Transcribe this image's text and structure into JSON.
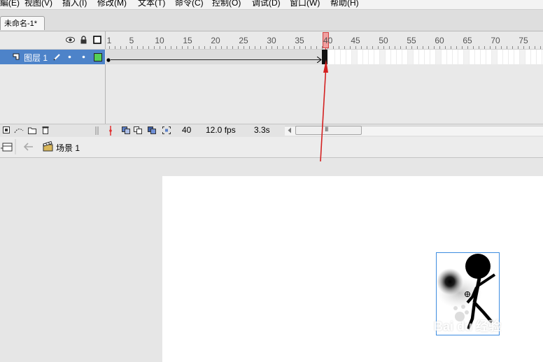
{
  "menu": {
    "items": [
      {
        "label": "編(E)"
      },
      {
        "label": "视图(V)"
      },
      {
        "label": "插入(I)"
      },
      {
        "label": "修改(M)"
      },
      {
        "label": "文本(T)"
      },
      {
        "label": "命令(C)"
      },
      {
        "label": "控制(O)"
      },
      {
        "label": "调试(D)"
      },
      {
        "label": "窗口(W)"
      },
      {
        "label": "帮助(H)"
      }
    ]
  },
  "document_tab": {
    "title": "未命名-1*"
  },
  "timeline": {
    "ruler_labels": [
      "1",
      "5",
      "10",
      "15",
      "20",
      "25",
      "30",
      "35",
      "40",
      "45",
      "50",
      "55",
      "60",
      "65",
      "70",
      "75"
    ],
    "current_frame_marker": "40",
    "layer": {
      "name": "图层 1",
      "icons": [
        "layer-icon",
        "pencil-icon",
        "eye-dot",
        "lock-dot",
        "outline-color-square"
      ]
    },
    "outline_color": "#55d055",
    "header_icons": [
      "eye-icon",
      "lock-icon",
      "outline-icon"
    ],
    "status": {
      "current_frame": "40",
      "frame_rate": "12.0 fps",
      "elapsed_time": "3.3s"
    },
    "scrollbar_grip": "III"
  },
  "scene_bar": {
    "scene_label": "场景 1"
  },
  "stage": {
    "watermark": "Bai du 经验",
    "selection_color": "#3c8ce0"
  },
  "accent_colors": {
    "playhead": "#e03030",
    "layer_selected": "#4d83c9"
  }
}
